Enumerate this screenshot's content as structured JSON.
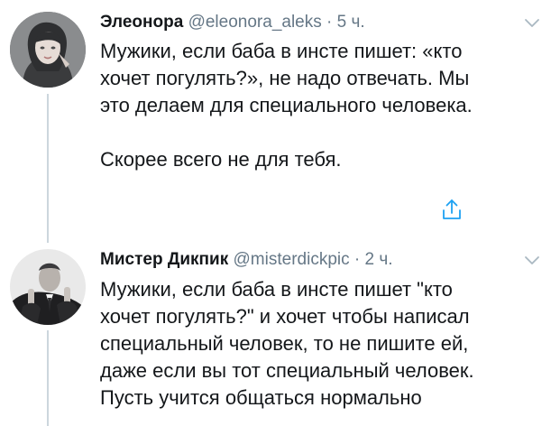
{
  "colors": {
    "text": "#14171a",
    "secondary": "#657786",
    "accent": "#1da1f2",
    "thread_line": "#ccd6dd"
  },
  "tweets": [
    {
      "display_name": "Элеонора",
      "handle": "@eleonora_aleks",
      "separator": "·",
      "time": "5 ч.",
      "text": "Мужики, если баба в инсте пишет: «кто\nхочет погулять?», не надо отвечать. Мы\nэто делаем для специального человека.\n\nСкорее всего не для тебя.",
      "avatar_icon": "avatar-photo",
      "menu_icon": "chevron-down-icon",
      "action_icon": "share-icon"
    },
    {
      "display_name": "Мистер Дикпик",
      "handle": "@misterdickpic",
      "separator": "·",
      "time": "2 ч.",
      "text": "Мужики, если баба в инсте пишет \"кто\nхочет погулять?\" и хочет чтобы написал\nспециальный человек, то не пишите ей,\nдаже если вы тот специальный человек.\nПусть учится общаться нормально",
      "avatar_icon": "avatar-photo",
      "menu_icon": "chevron-down-icon"
    }
  ]
}
